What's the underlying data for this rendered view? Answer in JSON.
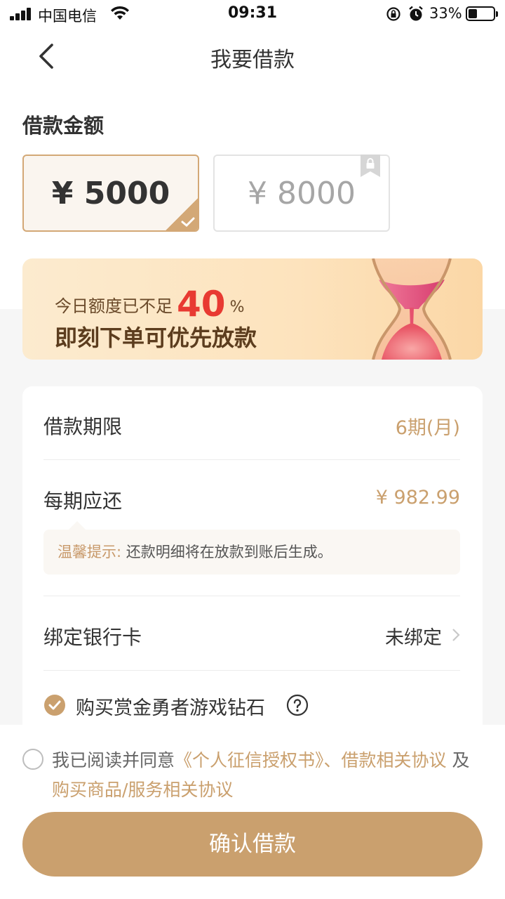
{
  "status_bar": {
    "carrier": "中国电信",
    "time": "09:31",
    "battery": "33%",
    "battery_level": 0.33
  },
  "nav": {
    "title": "我要借款",
    "back_icon": "chevron-left-icon"
  },
  "amount_section": {
    "label": "借款金额",
    "options": [
      {
        "text": "¥ 5000",
        "selected": true,
        "locked": false
      },
      {
        "text": "¥ 8000",
        "selected": false,
        "locked": true
      }
    ]
  },
  "banner": {
    "prefix": "今日额度已不足",
    "percent": "40",
    "percent_symbol": "%",
    "headline": "即刻下单可优先放款"
  },
  "details": {
    "term_label": "借款期限",
    "term_value": "6期(月)",
    "installment_label": "每期应还",
    "installment_value": "¥ 982.99",
    "tip_prefix": "温馨提示:",
    "tip_text": "还款明细将在放款到账后生成。",
    "bank_label": "绑定银行卡",
    "bank_value": "未绑定",
    "diamond_label": "购买赏金勇者游戏钻石"
  },
  "agreement": {
    "prefix": "我已阅读并同意",
    "link1": "《个人征信授权书》、借款相关协议",
    "joiner": " 及 ",
    "link2": "购买商品/服务相关协议"
  },
  "confirm_label": "确认借款",
  "colors": {
    "accent": "#caa06e",
    "highlight_red": "#e83a32"
  }
}
